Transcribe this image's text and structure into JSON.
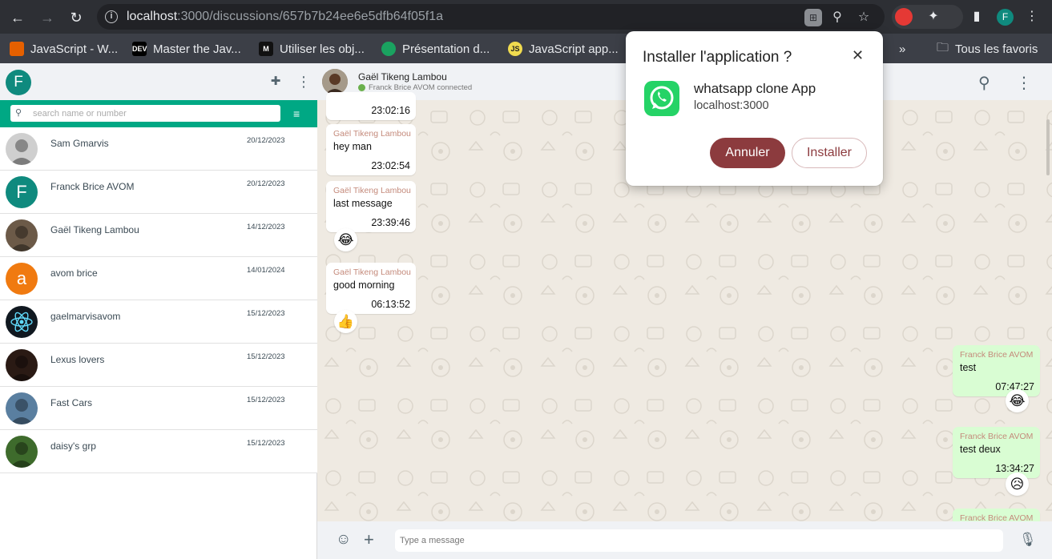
{
  "browser": {
    "url_host": "localhost",
    "url_rest": ":3000/discussions/657b7b24ee6e5dfb64f05f1a",
    "profile_initial": "F",
    "bookmarks": [
      {
        "label": "JavaScript - W...",
        "icon": "mdn-icon",
        "color": "#e66000"
      },
      {
        "label": "Master the Jav...",
        "icon": "dev-icon",
        "color": "#000000"
      },
      {
        "label": "Utiliser les obj...",
        "icon": "m-icon",
        "color": "#111111"
      },
      {
        "label": "Présentation d...",
        "icon": "globe-icon",
        "color": "#1aa260"
      },
      {
        "label": "JavaScript app...",
        "icon": "js-icon",
        "color": "#f0db4f"
      }
    ],
    "more_bookmarks": "»",
    "all_bookmarks_label": "Tous les favoris"
  },
  "sidebar": {
    "profile_initial": "F",
    "search_placeholder": "search name or number",
    "chats": [
      {
        "name": "Sam Gmarvis",
        "date": "20/12/2023",
        "avatar": "photo",
        "color": "#cfcfcf"
      },
      {
        "name": "Franck Brice AVOM",
        "date": "20/12/2023",
        "avatar": "F",
        "color": "#0f8a7e"
      },
      {
        "name": "Gaël Tikeng Lambou",
        "date": "14/12/2023",
        "avatar": "photo",
        "color": "#6c5a48"
      },
      {
        "name": "avom brice",
        "date": "14/01/2024",
        "avatar": "a",
        "color": "#f07a10"
      },
      {
        "name": "gaelmarvisavom",
        "date": "15/12/2023",
        "avatar": "react",
        "color": "#101820"
      },
      {
        "name": "Lexus lovers",
        "date": "15/12/2023",
        "avatar": "photo",
        "color": "#2a1a14"
      },
      {
        "name": "Fast Cars",
        "date": "15/12/2023",
        "avatar": "photo",
        "color": "#5a7fa0"
      },
      {
        "name": "daisy's grp",
        "date": "15/12/2023",
        "avatar": "photo",
        "color": "#3e6b2c"
      }
    ]
  },
  "chat": {
    "contact_name": "Gaël Tikeng Lambou",
    "status": "Franck Brice AVOM connected",
    "messages": [
      {
        "sender": "",
        "text": "",
        "time": "23:02:16",
        "reaction": ""
      },
      {
        "sender": "Gaël Tikeng Lambou",
        "text": "hey man",
        "time": "23:02:54",
        "reaction": ""
      },
      {
        "sender": "Gaël Tikeng Lambou",
        "text": "last message",
        "time": "23:39:46",
        "reaction": "😂"
      },
      {
        "sender": "Gaël Tikeng Lambou",
        "text": "good morning",
        "time": "06:13:52",
        "reaction": "👍"
      },
      {
        "sender": "Franck Brice AVOM",
        "text": "test",
        "time": "07:47:27",
        "reaction": "😂"
      },
      {
        "sender": "Franck Brice AVOM",
        "text": "test deux",
        "time": "13:34:27",
        "reaction": "😥"
      },
      {
        "sender": "Franck Brice AVOM",
        "text": "",
        "time": "",
        "reaction": ""
      }
    ],
    "input_placeholder": "Type a message"
  },
  "install_dialog": {
    "title": "Installer l'application ?",
    "app_name": "whatsapp clone App",
    "host": "localhost:3000",
    "cancel_label": "Annuler",
    "install_label": "Installer"
  }
}
